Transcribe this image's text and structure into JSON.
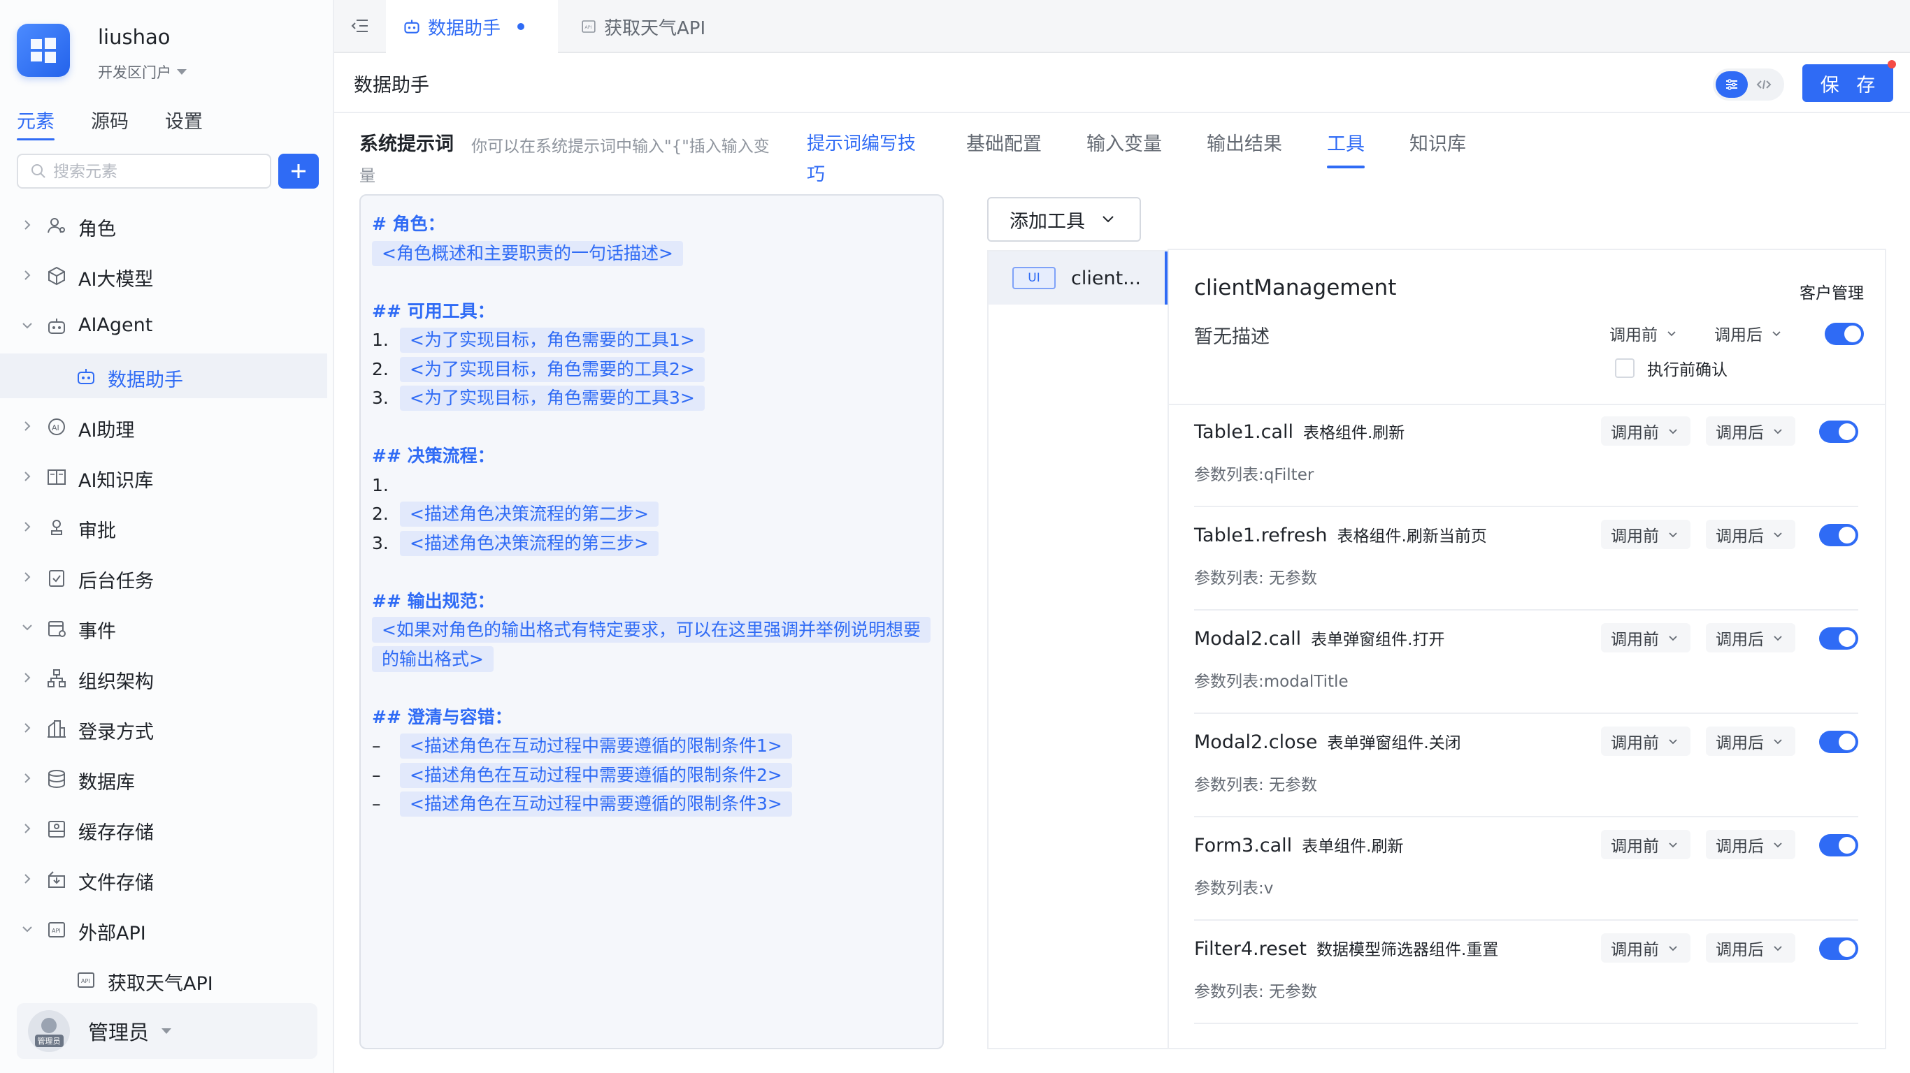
{
  "brand": {
    "user": "liushao",
    "portal": "开发区门户"
  },
  "sidebar": {
    "tabs": [
      {
        "label": "元素"
      },
      {
        "label": "源码"
      },
      {
        "label": "设置"
      }
    ],
    "search_placeholder": "搜索元素",
    "items": [
      {
        "label": "角色",
        "icon": "role-icon"
      },
      {
        "label": "AI大模型",
        "icon": "model-icon"
      },
      {
        "label": "AIAgent",
        "icon": "robot-icon"
      },
      {
        "label": "数据助手",
        "icon": "robot-icon"
      },
      {
        "label": "AI助理",
        "icon": "ai-assistant-icon"
      },
      {
        "label": "AI知识库",
        "icon": "book-icon"
      },
      {
        "label": "审批",
        "icon": "approval-icon"
      },
      {
        "label": "后台任务",
        "icon": "task-icon"
      },
      {
        "label": "事件",
        "icon": "event-icon"
      },
      {
        "label": "组织架构",
        "icon": "org-icon"
      },
      {
        "label": "登录方式",
        "icon": "login-icon"
      },
      {
        "label": "数据库",
        "icon": "database-icon"
      },
      {
        "label": "缓存存储",
        "icon": "cache-icon"
      },
      {
        "label": "文件存储",
        "icon": "file-storage-icon"
      },
      {
        "label": "外部API",
        "icon": "api-icon"
      },
      {
        "label": "获取天气API",
        "icon": "api-icon"
      }
    ],
    "admin": {
      "name": "管理员",
      "avatar_tag": "管理员"
    }
  },
  "tabbar": {
    "tabs": [
      {
        "label": "数据助手"
      },
      {
        "label": "获取天气API"
      }
    ]
  },
  "page": {
    "title": "数据助手",
    "save_label": "保 存"
  },
  "prompt": {
    "title": "系统提示词",
    "hint": "你可以在系统提示词中输入\"{\"插入输入变",
    "hint_wrap": "量",
    "link": "提示词编写技巧",
    "lines": {
      "role_h": "# 角色：",
      "role_ph": "<角色概述和主要职责的一句话描述>",
      "tools_h": "## 可用工具：",
      "tool1": "<为了实现目标，角色需要的工具1>",
      "tool2": "<为了实现目标，角色需要的工具2>",
      "tool3": "<为了实现目标，角色需要的工具3>",
      "flow_h": "## 决策流程：",
      "flow2": "<描述角色决策流程的第二步>",
      "flow3": "<描述角色决策流程的第三步>",
      "out_h": "## 输出规范：",
      "out_ph": "<如果对角色的输出格式有特定要求，可以在这里强调并举例说明想要的输出格式>",
      "clar_h": "## 澄清与容错：",
      "c1": "<描述角色在互动过程中需要遵循的限制条件1>",
      "c2": "<描述角色在互动过程中需要遵循的限制条件2>",
      "c3": "<描述角色在互动过程中需要遵循的限制条件3>",
      "n1": "1.",
      "n2": "2.",
      "n3": "3.",
      "dash": "–"
    }
  },
  "config": {
    "tabs": [
      {
        "label": "基础配置"
      },
      {
        "label": "输入变量"
      },
      {
        "label": "输出结果"
      },
      {
        "label": "工具"
      },
      {
        "label": "知识库"
      }
    ],
    "add_tool": "添加工具",
    "tool_list": [
      {
        "badge": "UI",
        "name": "client..."
      }
    ],
    "detail": {
      "name": "clientManagement",
      "category": "客户管理",
      "desc": "暂无描述",
      "before": "调用前",
      "after": "调用后",
      "confirm": "执行前确认"
    },
    "methods": [
      {
        "name": "Table1.call",
        "desc": "表格组件.刷新",
        "params": "参数列表:qFilter"
      },
      {
        "name": "Table1.refresh",
        "desc": "表格组件.刷新当前页",
        "params": "参数列表: 无参数"
      },
      {
        "name": "Modal2.call",
        "desc": "表单弹窗组件.打开",
        "params": "参数列表:modalTitle"
      },
      {
        "name": "Modal2.close",
        "desc": "表单弹窗组件.关闭",
        "params": "参数列表: 无参数"
      },
      {
        "name": "Form3.call",
        "desc": "表单组件.刷新",
        "params": "参数列表:v"
      },
      {
        "name": "Filter4.reset",
        "desc": "数据模型筛选器组件.重置",
        "params": "参数列表: 无参数"
      }
    ]
  },
  "colors": {
    "accent": "#2f6bf5",
    "placeholder_bg": "#e2e9fb",
    "badge_dot": "#f54a45"
  }
}
